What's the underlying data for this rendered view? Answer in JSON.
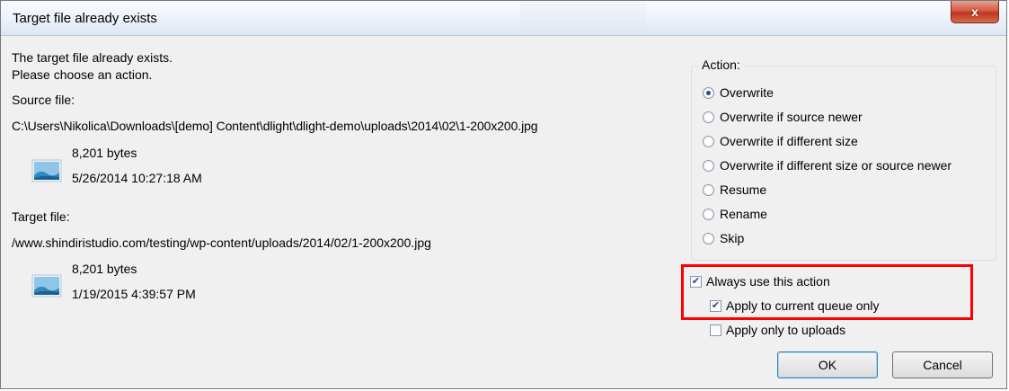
{
  "window": {
    "title": "Target file already exists",
    "close_glyph": "x",
    "background_items": [
      "",
      ""
    ]
  },
  "message": {
    "line1": "The target file already exists.",
    "line2": "Please choose an action."
  },
  "source": {
    "label": "Source file:",
    "path": "C:\\Users\\Nikolica\\Downloads\\[demo] Content\\dlight\\dlight-demo\\uploads\\2014\\02\\1-200x200.jpg",
    "size": "8,201 bytes",
    "date": "5/26/2014 10:27:18 AM",
    "icon": "image-file-icon"
  },
  "target": {
    "label": "Target file:",
    "path": "/www.shindiristudio.com/testing/wp-content/uploads/2014/02/1-200x200.jpg",
    "size": "8,201 bytes",
    "date": "1/19/2015 4:39:57 PM",
    "icon": "image-file-icon"
  },
  "action": {
    "legend": "Action:",
    "options": [
      {
        "label": "Overwrite",
        "selected": true
      },
      {
        "label": "Overwrite if source newer",
        "selected": false
      },
      {
        "label": "Overwrite if different size",
        "selected": false
      },
      {
        "label": "Overwrite if different size or source newer",
        "selected": false
      },
      {
        "label": "Resume",
        "selected": false
      },
      {
        "label": "Rename",
        "selected": false
      },
      {
        "label": "Skip",
        "selected": false
      }
    ]
  },
  "options": {
    "always_use": {
      "label": "Always use this action",
      "checked": true
    },
    "current_queue": {
      "label": "Apply to current queue only",
      "checked": true
    },
    "only_uploads": {
      "label": "Apply only to uploads",
      "checked": false
    }
  },
  "buttons": {
    "ok": "OK",
    "cancel": "Cancel"
  },
  "colors": {
    "highlight": "#ff0000",
    "close_button": "#c7432a"
  }
}
